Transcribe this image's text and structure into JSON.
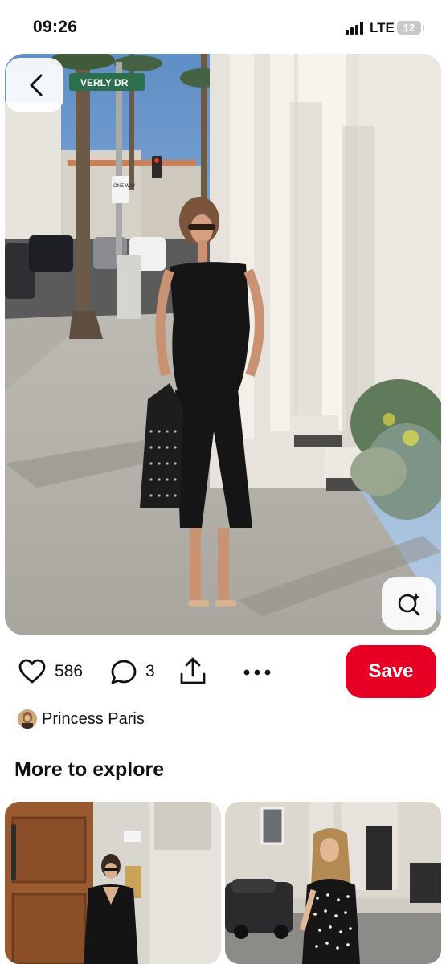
{
  "status_bar": {
    "time": "09:26",
    "network": "LTE",
    "battery": "12"
  },
  "pin": {
    "street_sign": "VERLY DR",
    "one_way_sign": "ONE WAY",
    "icons": {
      "back": "chevron-left-icon",
      "visual_search": "visual-search-icon"
    }
  },
  "actions": {
    "likes": "586",
    "comments": "3",
    "save_label": "Save",
    "icons": [
      "heart-icon",
      "comment-icon",
      "share-icon",
      "more-icon"
    ]
  },
  "creator": {
    "name": "Princess Paris"
  },
  "more_to_explore": {
    "title": "More to explore"
  },
  "colors": {
    "save_button": "#e60023",
    "text": "#111111"
  }
}
